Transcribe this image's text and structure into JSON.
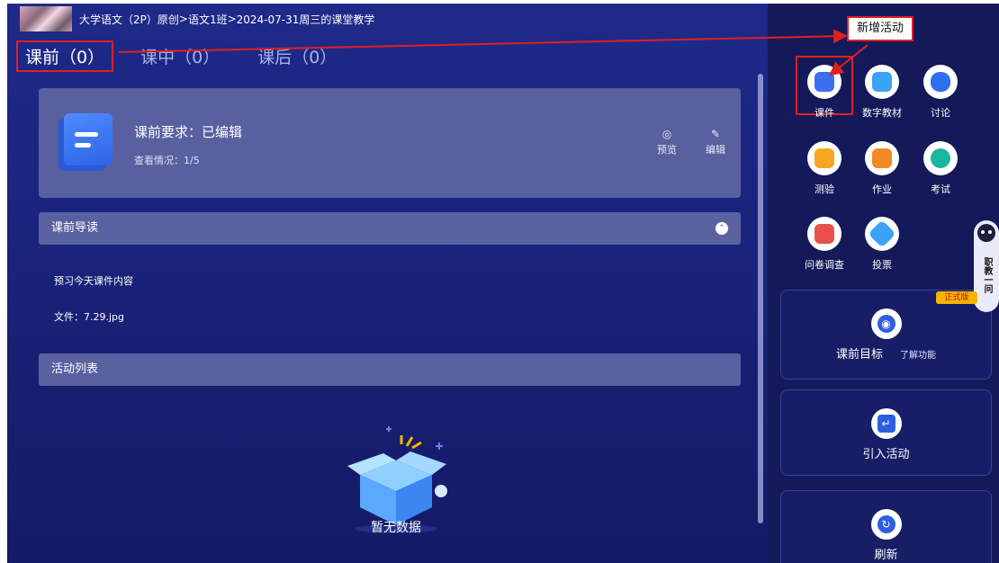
{
  "breadcrumb": {
    "course": "大学语文（2P）原创",
    "sep1": " > ",
    "class_name": "语文1班",
    "sep2": " > ",
    "lesson": "2024-07-31周三的课堂教学"
  },
  "tabs": [
    {
      "label": "课前（0）",
      "active": true
    },
    {
      "label": "课中（0）",
      "active": false
    },
    {
      "label": "课后（0）",
      "active": false
    }
  ],
  "requirement_card": {
    "title": "课前要求：已编辑",
    "subtitle": "查看情况：1/5",
    "preview_label": "预览",
    "edit_label": "编辑"
  },
  "guide_section": {
    "header": "课前导读",
    "text": "预习今天课件内容",
    "file": "文件：7.29.jpg"
  },
  "activity_section": {
    "header": "活动列表",
    "empty_text": "暂无数据"
  },
  "sidebar": {
    "new_activity_label": "新增活动",
    "tools": [
      {
        "label": "课件",
        "icon": "courseware-icon",
        "color": "#3b6ff0"
      },
      {
        "label": "数字教材",
        "icon": "digital-textbook-icon",
        "color": "#3aa3f5"
      },
      {
        "label": "讨论",
        "icon": "discussion-icon",
        "color": "#2e6ff0"
      },
      {
        "label": "测验",
        "icon": "quiz-icon",
        "color": "#f5a623"
      },
      {
        "label": "作业",
        "icon": "homework-icon",
        "color": "#f08a24"
      },
      {
        "label": "考试",
        "icon": "exam-icon",
        "color": "#19b7a0"
      },
      {
        "label": "问卷调查",
        "icon": "survey-icon",
        "color": "#e8504a"
      },
      {
        "label": "投票",
        "icon": "vote-icon",
        "color": "#3aa3f5"
      }
    ],
    "objective_label": "课前目标",
    "learn_more": "了解功能",
    "import_label": "引入活动",
    "refresh_label": "刷新"
  },
  "assistant": {
    "label": "职教一问",
    "badge": "正式版"
  }
}
